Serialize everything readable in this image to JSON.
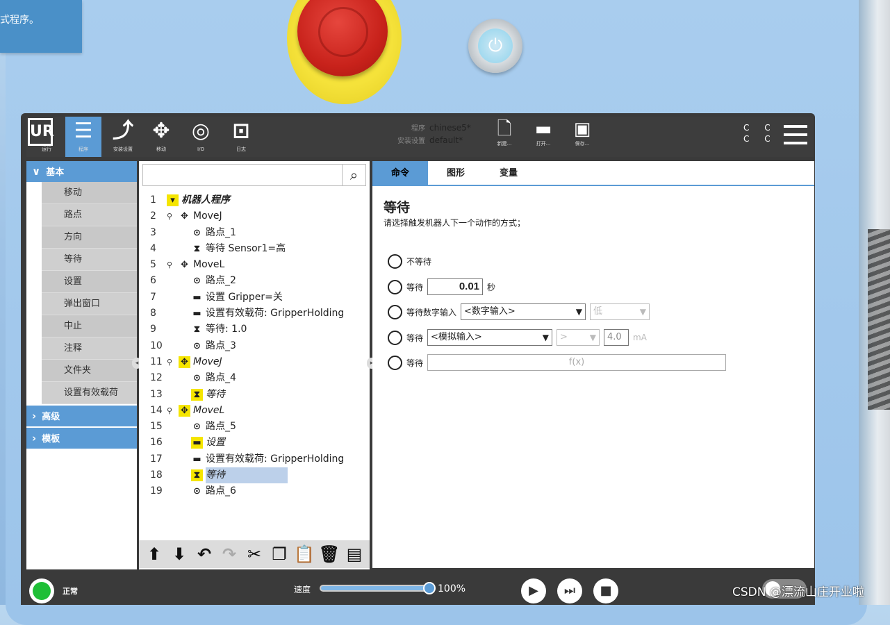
{
  "toast": {
    "text": "式程序。"
  },
  "header": {
    "tabs": [
      {
        "label": "运行",
        "icon": "ur-logo-icon"
      },
      {
        "label": "程序",
        "icon": "program-icon"
      },
      {
        "label": "安装设置",
        "icon": "installation-icon"
      },
      {
        "label": "移动",
        "icon": "move-icon"
      },
      {
        "label": "I/O",
        "icon": "io-icon"
      },
      {
        "label": "日志",
        "icon": "log-icon"
      }
    ],
    "program_key": "程序",
    "program_value": "chinese5*",
    "installation_key": "安装设置",
    "installation_value": "default*",
    "file_buttons": {
      "new": "新建...",
      "open": "打开...",
      "save": "保存..."
    },
    "cc_text": "C C"
  },
  "sidebar": {
    "basic_header": "基本",
    "items": [
      "移动",
      "路点",
      "方向",
      "等待",
      "设置",
      "弹出窗口",
      "中止",
      "注释",
      "文件夹",
      "设置有效载荷"
    ],
    "advanced_header": "高级",
    "template_header": "模板"
  },
  "tree": {
    "search_placeholder": "",
    "rows": [
      {
        "num": "1",
        "label": "机器人程序"
      },
      {
        "num": "2",
        "label": "MoveJ"
      },
      {
        "num": "3",
        "label": "路点_1"
      },
      {
        "num": "4",
        "label": "等待 Sensor1=高"
      },
      {
        "num": "5",
        "label": "MoveL"
      },
      {
        "num": "6",
        "label": "路点_2"
      },
      {
        "num": "7",
        "label": "设置 Gripper=关"
      },
      {
        "num": "8",
        "label": "设置有效载荷: GripperHolding"
      },
      {
        "num": "9",
        "label": "等待: 1.0"
      },
      {
        "num": "10",
        "label": "路点_3"
      },
      {
        "num": "11",
        "label": "MoveJ"
      },
      {
        "num": "12",
        "label": "路点_4"
      },
      {
        "num": "13",
        "label": "等待"
      },
      {
        "num": "14",
        "label": "MoveL"
      },
      {
        "num": "15",
        "label": "路点_5"
      },
      {
        "num": "16",
        "label": "设置"
      },
      {
        "num": "17",
        "label": "设置有效载荷: GripperHolding"
      },
      {
        "num": "18",
        "label": "等待"
      },
      {
        "num": "19",
        "label": "路点_6"
      }
    ]
  },
  "command": {
    "tabs": [
      "命令",
      "图形",
      "变量"
    ],
    "title": "等待",
    "description": "请选择触发机器人下一个动作的方式；",
    "opt_no_wait": "不等待",
    "opt_wait": "等待",
    "wait_value": "0.01",
    "wait_unit": "秒",
    "opt_digital": "等待数字输入",
    "digital_select": "<数字输入>",
    "digital_level": "低",
    "analog_select": "<模拟输入>",
    "analog_op": ">",
    "analog_value": "4.0",
    "analog_unit": "mA",
    "expression": "f(x)"
  },
  "footer": {
    "status": "正常",
    "speed_label": "速度",
    "speed_value": "100%",
    "speed_fraction": 1.0,
    "watermark": "CSDN @漂流山庄开业啦"
  },
  "colors": {
    "accent": "#5b9bd5",
    "highlight": "#f5e500",
    "selection": "#bcd0ea",
    "status_ok": "#1fbf37"
  }
}
